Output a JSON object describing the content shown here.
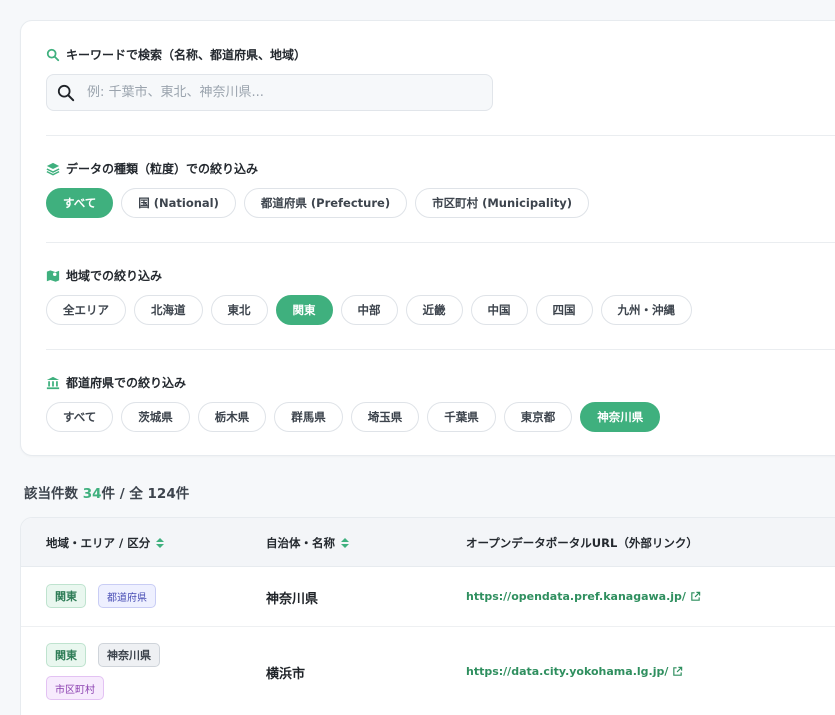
{
  "filters": {
    "search": {
      "label": "キーワードで検索（名称、都道府県、地域）",
      "placeholder": "例: 千葉市、東北、神奈川県...",
      "value": ""
    },
    "granularity": {
      "label": "データの種類（粒度）での絞り込み",
      "options": [
        "すべて",
        "国 (National)",
        "都道府県 (Prefecture)",
        "市区町村 (Municipality)"
      ],
      "selected": "すべて"
    },
    "region": {
      "label": "地域での絞り込み",
      "options": [
        "全エリア",
        "北海道",
        "東北",
        "関東",
        "中部",
        "近畿",
        "中国",
        "四国",
        "九州・沖縄"
      ],
      "selected": "関東"
    },
    "prefecture": {
      "label": "都道府県での絞り込み",
      "options": [
        "すべて",
        "茨城県",
        "栃木県",
        "群馬県",
        "埼玉県",
        "千葉県",
        "東京都",
        "神奈川県"
      ],
      "selected": "神奈川県"
    }
  },
  "results": {
    "prefix": "該当件数 ",
    "count": "34",
    "suffix": "件 / 全 124件"
  },
  "table": {
    "headers": [
      "地域・エリア / 区分",
      "自治体・名称",
      "オープンデータポータルURL（外部リンク）"
    ],
    "rows": [
      {
        "region": "関東",
        "type": "都道府県",
        "parent": "",
        "name": "神奈川県",
        "url": "https://opendata.pref.kanagawa.jp/"
      },
      {
        "region": "関東",
        "type": "市区町村",
        "parent": "神奈川県",
        "name": "横浜市",
        "url": "https://data.city.yokohama.lg.jp/"
      }
    ]
  },
  "colors": {
    "accent": "#3fb07e",
    "link": "#2f8f5f"
  },
  "icons": {
    "search_label": "search-icon",
    "search_input": "search-icon",
    "granularity": "layers-icon",
    "region": "map-icon",
    "prefecture": "building-icon",
    "sort": "sort-icon",
    "external": "external-link-icon"
  }
}
